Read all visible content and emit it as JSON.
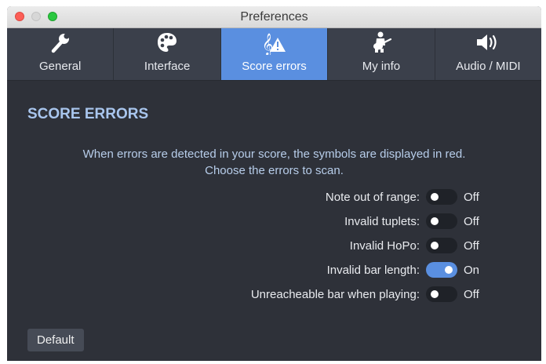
{
  "window": {
    "title": "Preferences"
  },
  "tabs": [
    {
      "label": "General",
      "icon": "wrench-icon",
      "active": false
    },
    {
      "label": "Interface",
      "icon": "palette-icon",
      "active": false
    },
    {
      "label": "Score errors",
      "icon": "clef-warning-icon",
      "active": true
    },
    {
      "label": "My info",
      "icon": "guitarist-icon",
      "active": false
    },
    {
      "label": "Audio / MIDI",
      "icon": "speaker-icon",
      "active": false
    }
  ],
  "section": {
    "title": "SCORE ERRORS",
    "desc_line1": "When errors are detected in your score, the symbols are displayed in red.",
    "desc_line2": "Choose the errors to scan."
  },
  "options": [
    {
      "label": "Note out of range:",
      "value": "Off",
      "on": false
    },
    {
      "label": "Invalid tuplets:",
      "value": "Off",
      "on": false
    },
    {
      "label": "Invalid HoPo:",
      "value": "Off",
      "on": false
    },
    {
      "label": "Invalid bar length:",
      "value": "On",
      "on": true
    },
    {
      "label": "Unreacheable bar when playing:",
      "value": "Off",
      "on": false
    }
  ],
  "default_button": "Default",
  "colors": {
    "accent": "#5a8fe0",
    "background": "#2e3139",
    "tabbar": "#3b404b",
    "title": "#a9c6ee"
  }
}
